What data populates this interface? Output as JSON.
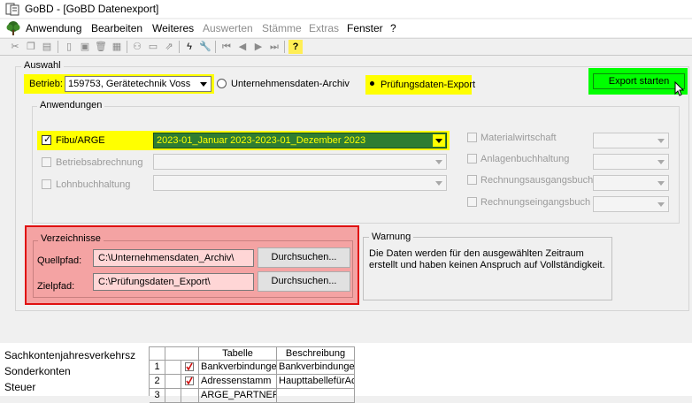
{
  "window": {
    "title": "GoBD - [GoBD Datenexport]"
  },
  "menu": {
    "items": [
      {
        "label": "Anwendung",
        "enabled": true
      },
      {
        "label": "Bearbeiten",
        "enabled": true
      },
      {
        "label": "Weiteres",
        "enabled": true
      },
      {
        "label": "Auswerten",
        "enabled": false
      },
      {
        "label": "Stämme",
        "enabled": false
      },
      {
        "label": "Extras",
        "enabled": false
      },
      {
        "label": "Fenster",
        "enabled": true
      },
      {
        "label": "?",
        "enabled": true
      }
    ]
  },
  "auswahl": {
    "legend": "Auswahl",
    "betrieb_label": "Betrieb:",
    "betrieb_value": "159753, Gerätetechnik Voss",
    "radio_archiv_label": "Unternehmensdaten-Archiv",
    "radio_pruefung_label": "Prüfungsdaten-Export",
    "export_button": "Export starten"
  },
  "anwendungen": {
    "legend": "Anwendungen",
    "fibu_label": "Fibu/ARGE",
    "fibu_period": "2023-01_Januar 2023-2023-01_Dezember 2023",
    "betriebsabrechnung_label": "Betriebsabrechnung",
    "lohnbuchhaltung_label": "Lohnbuchhaltung",
    "materialwirtschaft_label": "Materialwirtschaft",
    "anlagenbuchhaltung_label": "Anlagenbuchhaltung",
    "rechnungsausgangsbuch_label": "Rechnungsausgangsbuch",
    "rechnungseingangsbuch_label": "Rechnungseingangsbuch"
  },
  "verzeichnisse": {
    "legend": "Verzeichnisse",
    "quellpfad_label": "Quellpfad:",
    "quellpfad_value": "C:\\Unternehmensdaten_Archiv\\",
    "zielpfad_label": "Zielpfad:",
    "zielpfad_value": "C:\\Prüfungsdaten_Export\\",
    "browse_label": "Durchsuchen..."
  },
  "warnung": {
    "legend": "Warnung",
    "line1": "Die Daten werden für den ausgewählten Zeitraum",
    "line2": "erstellt und haben keinen Anspruch auf Vollständigkeit."
  },
  "bottom_list": {
    "items": [
      "Sachkontenjahresverkehrsz",
      "Sonderkonten",
      "Steuer"
    ]
  },
  "table": {
    "headers": [
      "Tabelle",
      "Beschreibung"
    ],
    "rows": [
      {
        "num": "1",
        "tabelle": "Bankverbindunge",
        "beschreibung": "Bankverbindunge"
      },
      {
        "num": "2",
        "tabelle": "Adressenstamm",
        "beschreibung": "HaupttabellefürAc"
      },
      {
        "num": "3",
        "tabelle": "ARGE_PARTNER",
        "beschreibung": ""
      }
    ]
  },
  "colors": {
    "highlight_yellow": "#ffff00",
    "highlight_green": "#00ff00",
    "period_selected_bg": "#2e7d32",
    "verzeichnisse_red_border": "#e01010",
    "verzeichnisse_fill": "#f4a3a3"
  }
}
